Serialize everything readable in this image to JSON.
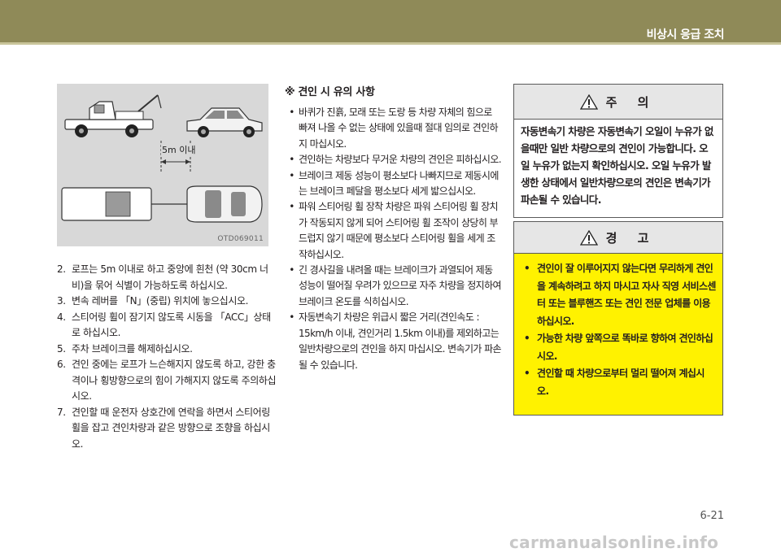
{
  "header": {
    "title": "비상시 응급 조치"
  },
  "figure": {
    "code": "OTD069011",
    "distance_label": "5m 이내"
  },
  "steps": [
    {
      "num": "2.",
      "text": "로프는 5m 이내로 하고 중앙에 흰천 (약 30cm 너비)을 묶어 식별이 가능하도록 하십시오."
    },
    {
      "num": "3.",
      "text": "변속 레버를 「N」(중립) 위치에 놓으십시오."
    },
    {
      "num": "4.",
      "text": "스티어링 휠이 잠기지 않도록 시동을 「ACC」상태로 하십시오."
    },
    {
      "num": "5.",
      "text": "주차 브레이크를 해제하십시오."
    },
    {
      "num": "6.",
      "text": "견인 중에는 로프가 느슨해지지 않도록 하고, 강한 충격이나 횡방향으로의 힘이 가해지지 않도록 주의하십시오."
    },
    {
      "num": "7.",
      "text": "견인할 때 운전자 상호간에 연락을 하면서 스티어링 휠을 잡고 견인차량과 같은 방향으로 조향을 하십시오."
    }
  ],
  "notes": {
    "mark": "※",
    "title": "견인 시 유의 사항",
    "items": [
      "바퀴가 진흙, 모래 또는 도랑 등 차량 자체의 힘으로 빠져 나올 수 없는 상태에 있을때 절대 임의로 견인하지 마십시오.",
      "견인하는 차량보다 무거운 차량의 견인은 피하십시오.",
      "브레이크 제동 성능이 평소보다 나빠지므로 제동시에는 브레이크 페달을 평소보다 세게 밟으십시오.",
      "파워 스티어링 휠 장착 차량은 파워 스티어링 휠 장치가 작동되지 않게 되어 스티어링 휠 조작이 상당히 부드럽지 않기 때문에 평소보다 스티어링 휠을 세게 조작하십시오.",
      "긴 경사길을 내려올 때는 브레이크가 과열되어 제동 성능이 떨어질 우려가 있으므로 자주 차량을 정지하여 브레이크 온도를 식히십시오.",
      "자동변속기 차량은 위급시 짧은 거리(견인속도 : 15km/h 이내, 견인거리 1.5km 이내)를 제외하고는 일반차량으로의 견인을 하지 마십시오. 변속기가 파손될 수 있습니다."
    ]
  },
  "caution": {
    "title": "주 의",
    "text": "자동변속기 차량은 자동변속기 오일이 누유가 없을때만 일반 차량으로의 견인이 가능합니다. 오일 누유가 없는지 확인하십시오. 오일 누유가 발생한 상태에서 일반차량으로의 견인은 변속기가 파손될 수 있습니다."
  },
  "warning": {
    "title": "경 고",
    "items": [
      "견인이 잘 이루어지지 않는다면 무리하게 견인을 계속하려고 하지 마시고 자사 직영 서비스센터 또는 블루핸즈 또는 견인 전문 업체를 이용하십시오.",
      "가능한 차량 앞쪽으로 똑바로 향하여 견인하십시오.",
      "견인할 때 차량으로부터 멀리 떨어져 계십시오."
    ]
  },
  "page_number": "6-21",
  "watermark": "carmanualsonline.info"
}
